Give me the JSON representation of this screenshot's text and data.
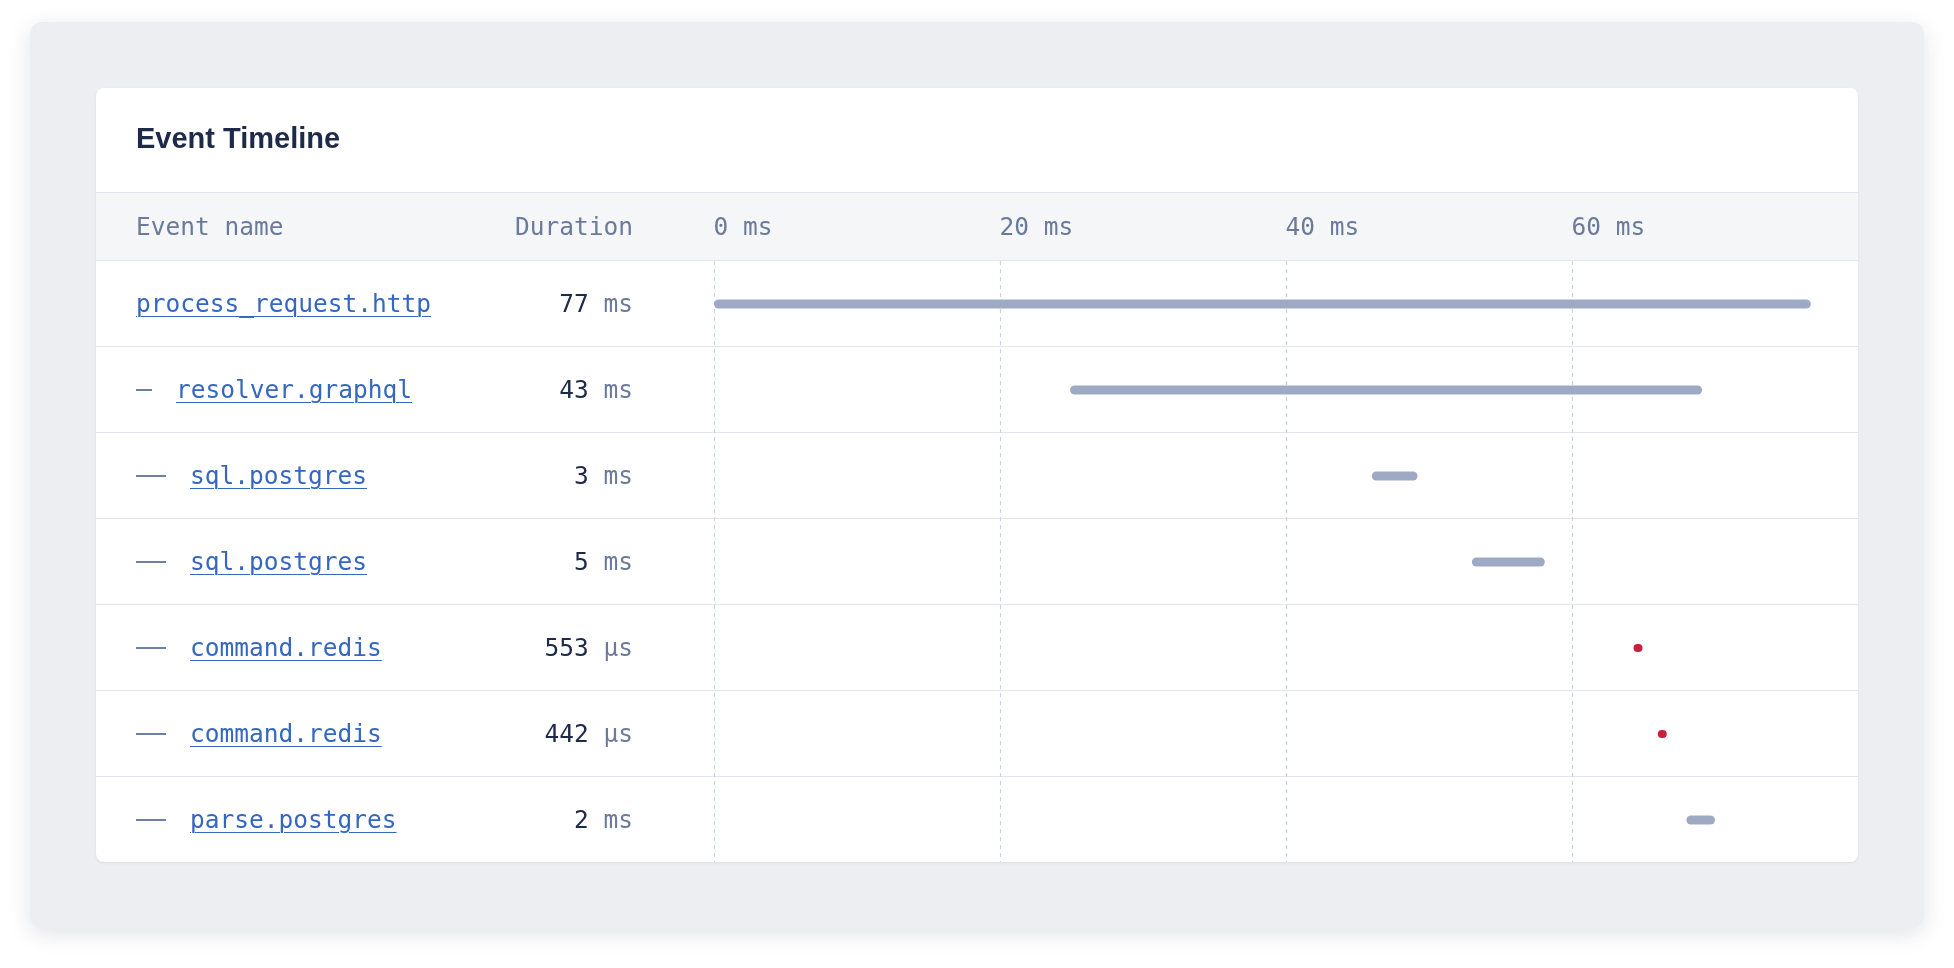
{
  "card": {
    "title": "Event Timeline"
  },
  "columns": [
    "Event name",
    "Duration"
  ],
  "timeline_ticks": [
    "0 ms",
    "20 ms",
    "40 ms",
    "60 ms"
  ],
  "events": [
    {
      "name": "process_request.http",
      "duration": {
        "value": "77",
        "unit": "ms"
      },
      "color": "#9eaac3",
      "children": [
        {
          "name": "resolver.graphql",
          "duration": {
            "value": "43",
            "unit": "ms"
          },
          "color": "#9eaac3",
          "children": [
            {
              "name": "sql.postgres",
              "duration": {
                "value": "3",
                "unit": "ms"
              },
              "color": "#9eaac3"
            },
            {
              "name": "sql.postgres",
              "duration": {
                "value": "5",
                "unit": "ms"
              },
              "color": "#9eaac3"
            },
            {
              "name": "command.redis",
              "duration": {
                "value": "553",
                "unit": "µs"
              },
              "color": "#c8203e"
            },
            {
              "name": "command.redis",
              "duration": {
                "value": "442",
                "unit": "µs"
              },
              "color": "#c8203e"
            },
            {
              "name": "parse.postgres",
              "duration": {
                "value": "2",
                "unit": "ms"
              },
              "color": "#9eaac3"
            }
          ]
        }
      ]
    }
  ]
}
